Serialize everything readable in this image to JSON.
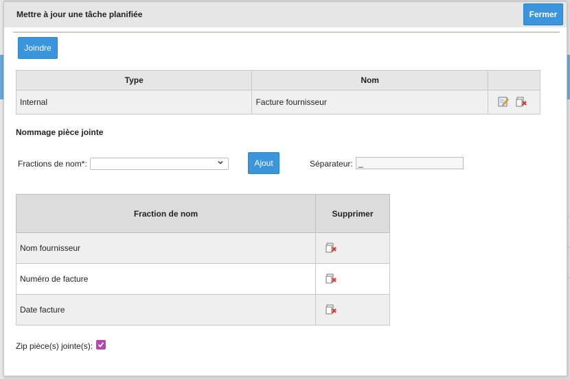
{
  "dialog": {
    "title": "Mettre à jour une tâche planifiée",
    "close_label": "Fermer",
    "attach_label": "Joindre"
  },
  "attachments_table": {
    "headers": [
      "Type",
      "Nom",
      ""
    ],
    "rows": [
      {
        "type": "Internal",
        "name": "Facture fournisseur",
        "actions": [
          "edit-icon",
          "delete-icon"
        ]
      }
    ]
  },
  "naming": {
    "section_title": "Nommage pièce jointe",
    "fractions_label": "Fractions de nom*:",
    "fractions_selected": "",
    "add_label": "Ajout",
    "separator_label": "Séparateur:",
    "separator_value": "_"
  },
  "fractions_table": {
    "headers": [
      "Fraction de nom",
      "Supprimer"
    ],
    "rows": [
      {
        "name": "Nom fournisseur"
      },
      {
        "name": "Numéro de facture"
      },
      {
        "name": "Date facture"
      }
    ]
  },
  "zip": {
    "label": "Zip pièce(s) jointe(s):",
    "checked": true
  },
  "colors": {
    "accent": "#3a95dd",
    "checkbox": "#b24aa8"
  }
}
